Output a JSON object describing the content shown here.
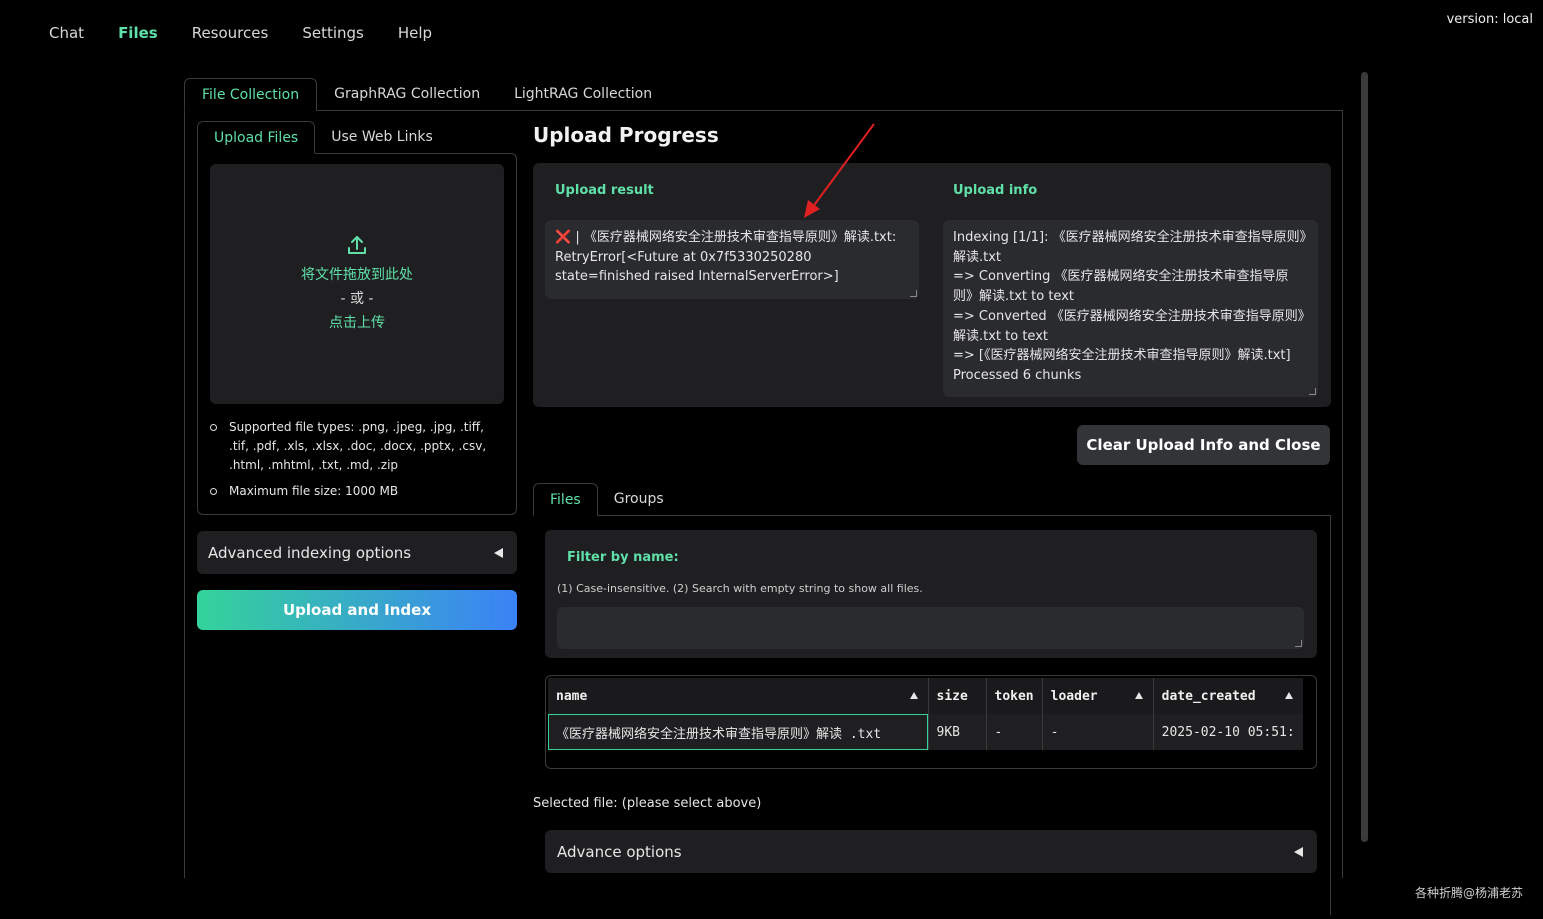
{
  "nav": {
    "items": [
      "Chat",
      "Files",
      "Resources",
      "Settings",
      "Help"
    ],
    "version": "version: local"
  },
  "main_tabs": [
    "File Collection",
    "GraphRAG Collection",
    "LightRAG Collection"
  ],
  "upload": {
    "tabs": [
      "Upload Files",
      "Use Web Links"
    ],
    "drop_text": "将文件拖放到此处",
    "or_text": "- 或 -",
    "click_text": "点击上传",
    "supported": "Supported file types: .png, .jpeg, .jpg, .tiff, .tif, .pdf, .xls, .xlsx, .doc, .docx, .pptx, .csv, .html, .mhtml, .txt, .md, .zip",
    "max_size": "Maximum file size: 1000 MB",
    "advanced_label": "Advanced indexing options",
    "upload_button": "Upload and Index"
  },
  "progress": {
    "title": "Upload Progress",
    "result_label": "Upload result",
    "result_icon": "❌",
    "result_text": " | 《医疗器械网络安全注册技术审查指导原则》解读.txt: RetryError[<Future at 0x7f5330250280 state=finished raised InternalServerError>]",
    "info_label": "Upload info",
    "info_lines": [
      "Indexing [1/1]: 《医疗器械网络安全注册技术审查指导原则》解读.txt",
      " => Converting 《医疗器械网络安全注册技术审查指导原则》解读.txt to text",
      " => Converted 《医疗器械网络安全注册技术审查指导原则》解读.txt to text",
      " => [《医疗器械网络安全注册技术审查指导原则》解读.txt] Processed 6 chunks"
    ],
    "clear_button": "Clear Upload Info and Close"
  },
  "files": {
    "tabs": [
      "Files",
      "Groups"
    ],
    "filter_label": "Filter by name:",
    "filter_hint": "(1) Case-insensitive. (2) Search with empty string to show all files.",
    "columns": [
      "name",
      "size",
      "token",
      "loader",
      "date_created"
    ],
    "rows": [
      [
        "《医疗器械网络安全注册技术审查指导原则》解读 .txt",
        "9KB",
        "-",
        "-",
        "2025-02-10 05:51:"
      ]
    ],
    "selected_file": "Selected file: (please select above)",
    "advance_label": "Advance options"
  },
  "watermark": "各种折腾@杨浦老苏",
  "colors": {
    "accent": "#5fe0a8",
    "error": "#e34b4b",
    "arrow": "#e02020"
  }
}
